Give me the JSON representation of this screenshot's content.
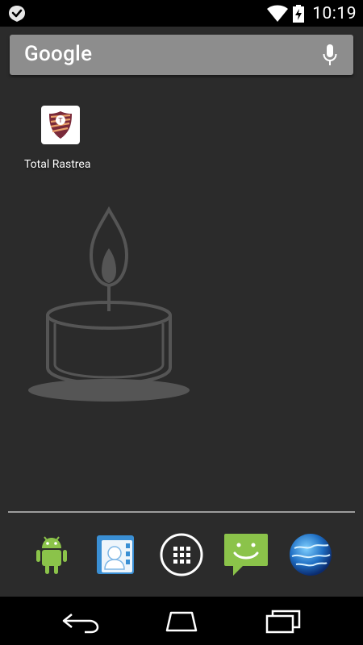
{
  "status_bar": {
    "time": "10:19",
    "left_icon": "notification-check-icon",
    "wifi_icon": "wifi-icon",
    "battery_icon": "battery-charging-icon"
  },
  "search_bar": {
    "logo_text": "Google",
    "mic_icon": "microphone-icon"
  },
  "home_apps": [
    {
      "label": "Total Rastrea",
      "icon": "total-rastreamento-icon"
    }
  ],
  "wallpaper": {
    "illustration": "candle-icon"
  },
  "dock": [
    {
      "name": "android-app",
      "icon": "android-icon"
    },
    {
      "name": "contacts",
      "icon": "contacts-icon"
    },
    {
      "name": "all-apps",
      "icon": "app-drawer-icon"
    },
    {
      "name": "messaging",
      "icon": "messaging-icon"
    },
    {
      "name": "browser",
      "icon": "globe-icon"
    }
  ],
  "navigation": {
    "back_icon": "back-icon",
    "home_icon": "home-icon",
    "recents_icon": "recents-icon"
  },
  "colors": {
    "background": "#2b2b2b",
    "search_bar": "#8d8d8d",
    "messaging_green": "#8bc34a",
    "android_green": "#8bc34a"
  }
}
